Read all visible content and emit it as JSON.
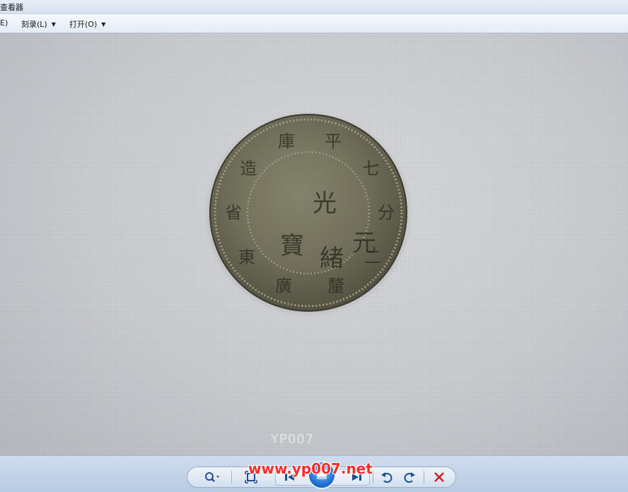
{
  "window": {
    "title": "查看器"
  },
  "menubar": {
    "items": [
      {
        "label": "E)"
      },
      {
        "label": "刻录(L)"
      },
      {
        "label": "打开(O)"
      }
    ]
  },
  "image": {
    "subject": "coin photograph",
    "coin_inscriptions": [
      "光",
      "緒",
      "元",
      "寶",
      "廣",
      "東",
      "省",
      "造",
      "庫",
      "平",
      "七",
      "分",
      "二",
      "釐"
    ]
  },
  "watermark": {
    "faint_text": "YP007",
    "site_text": "www.yp007.net",
    "site_color": "#ff2b2b"
  },
  "toolbar": {
    "buttons": [
      {
        "icon": "zoom-icon"
      },
      {
        "icon": "fit-window-icon"
      },
      {
        "icon": "previous-icon"
      },
      {
        "icon": "slideshow-icon"
      },
      {
        "icon": "next-icon"
      },
      {
        "icon": "rotate-left-icon"
      },
      {
        "icon": "rotate-right-icon"
      },
      {
        "icon": "delete-icon"
      }
    ],
    "accent_color": "#1f4f8f",
    "delete_color": "#d21f1f"
  }
}
